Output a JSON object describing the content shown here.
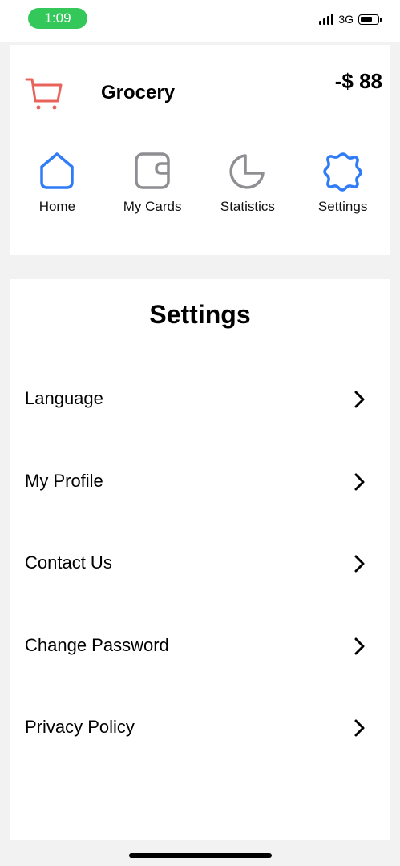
{
  "status_bar": {
    "time": "1:09",
    "network": "3G",
    "battery_level": 0.75,
    "time_pill_color": "#34c759"
  },
  "summary": {
    "category": "Grocery",
    "amount": "-$ 88",
    "icon": "shopping-cart-icon",
    "icon_color": "#e8635c"
  },
  "nav": {
    "accent_color": "#2f7cf6",
    "inactive_color": "#8e8e93",
    "items": [
      {
        "label": "Home",
        "icon": "home-icon",
        "active": true
      },
      {
        "label": "My Cards",
        "icon": "wallet-icon",
        "active": false
      },
      {
        "label": "Statistics",
        "icon": "pie-chart-icon",
        "active": false
      },
      {
        "label": "Settings",
        "icon": "gear-icon",
        "active": true
      }
    ]
  },
  "settings": {
    "title": "Settings",
    "items": [
      {
        "label": "Language",
        "icon": "chevron-right-icon"
      },
      {
        "label": "My Profile",
        "icon": "chevron-right-icon"
      },
      {
        "label": "Contact Us",
        "icon": "chevron-right-icon"
      },
      {
        "label": "Change Password",
        "icon": "chevron-right-icon"
      },
      {
        "label": "Privacy Policy",
        "icon": "chevron-right-icon"
      }
    ]
  }
}
